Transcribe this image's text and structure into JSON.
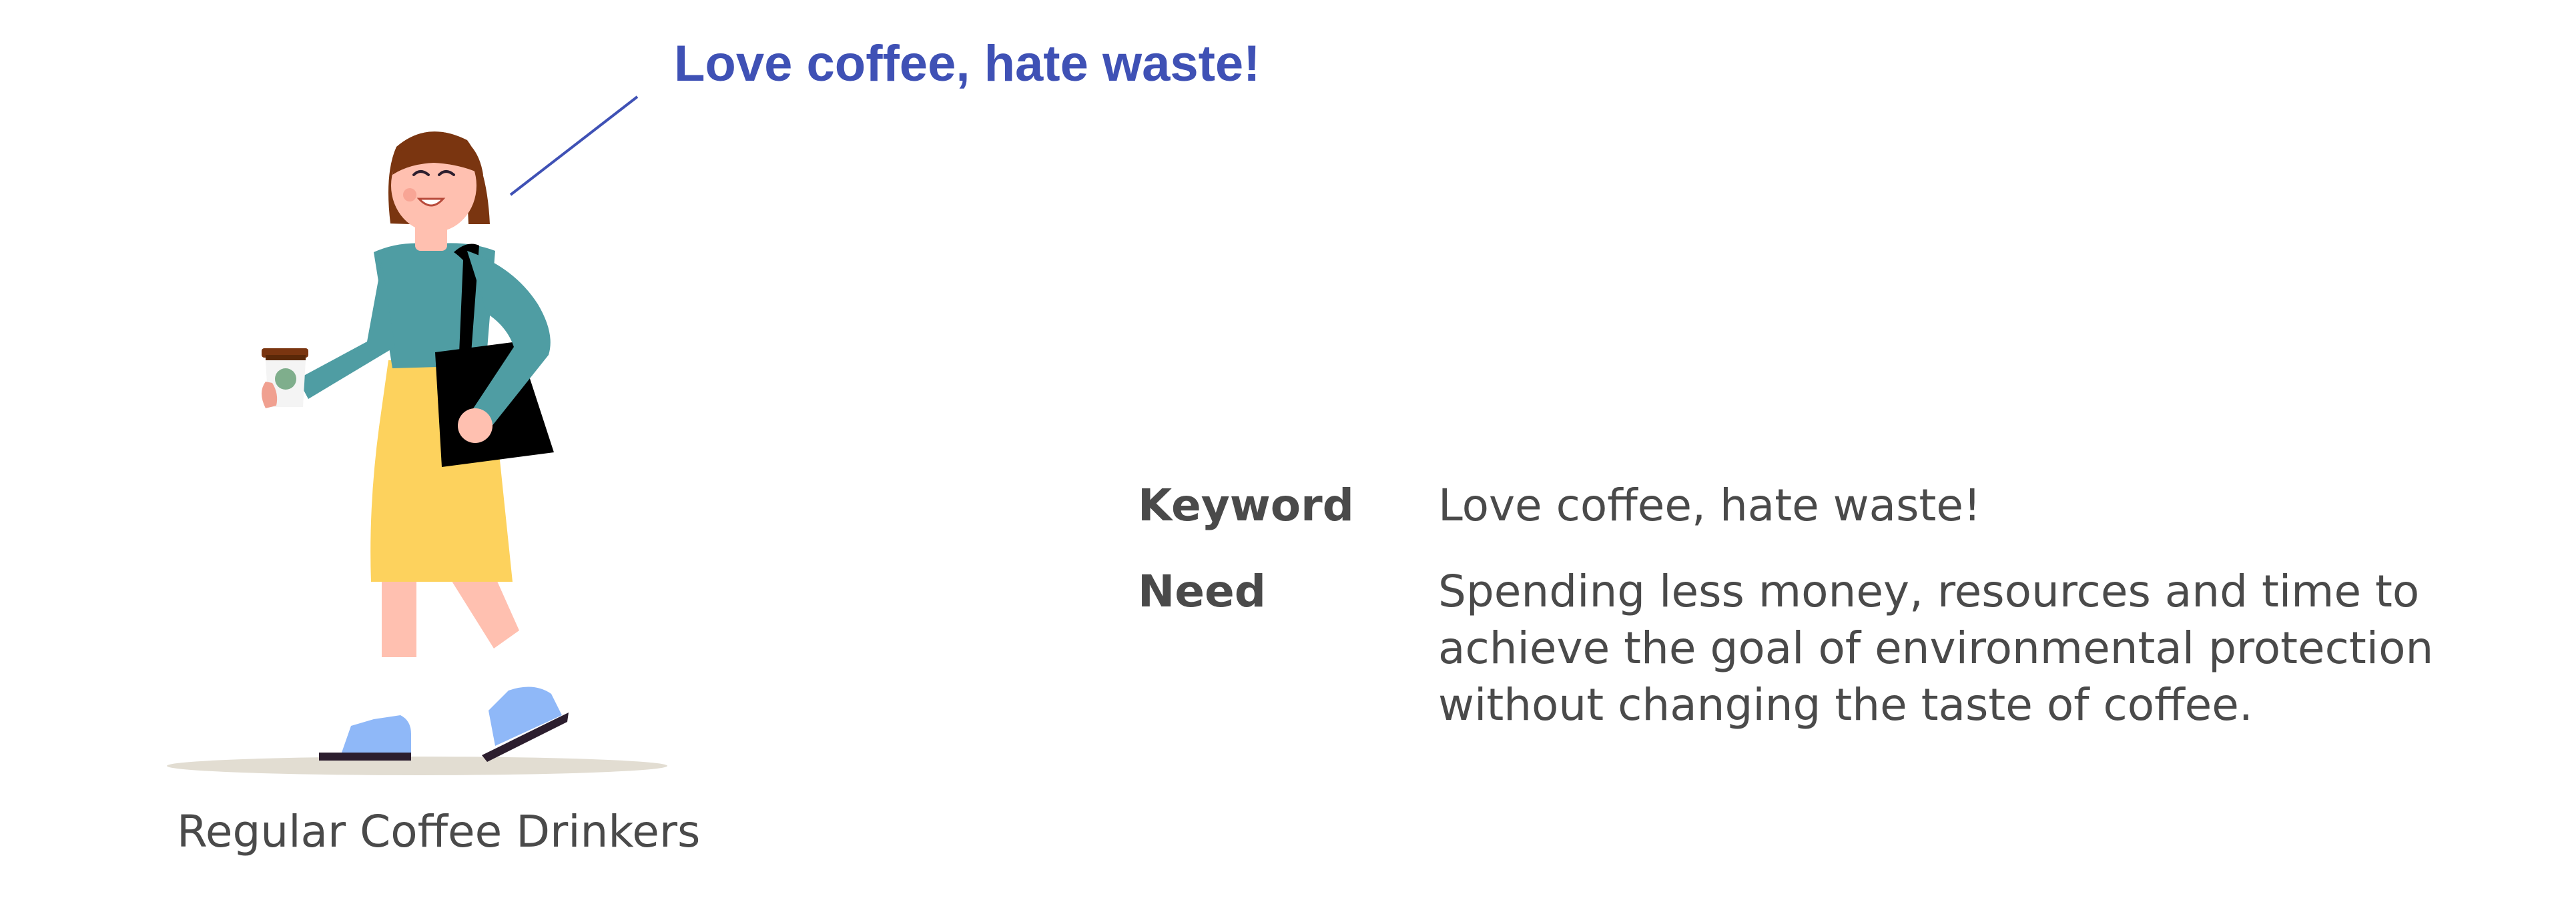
{
  "speech": {
    "text": "Love coffee, hate waste!"
  },
  "persona": {
    "caption": "Regular Coffee Drinkers"
  },
  "details": {
    "keyword": {
      "label": "Keyword",
      "value": "Love coffee, hate waste!"
    },
    "need": {
      "label": "Need",
      "value": "Spending less money, resources and time to achieve the goal of environmental protection without changing the taste of coffee."
    }
  },
  "colors": {
    "accent": "#3f51b5",
    "text": "#4a4a4a",
    "shirt": "#4f9da3",
    "skirt": "#fdd25d",
    "hair": "#7a3510",
    "skin": "#ffc0b0",
    "shoes": "#8fb8f8",
    "ground": "#e2ddd2"
  }
}
